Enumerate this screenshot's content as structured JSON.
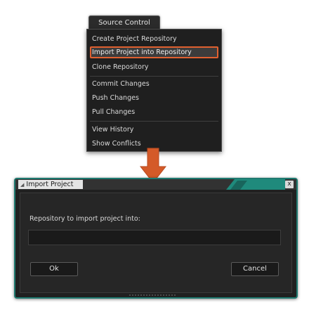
{
  "menu": {
    "title": "Source Control",
    "items": [
      {
        "label": "Create Project Repository"
      },
      {
        "label": "Import Project into Repository"
      },
      {
        "label": "Clone Repository"
      },
      {
        "label": "Commit Changes"
      },
      {
        "label": "Push Changes"
      },
      {
        "label": "Pull Changes"
      },
      {
        "label": "View History"
      },
      {
        "label": "Show Conflicts"
      }
    ],
    "selected_item": "Import Project into Repository"
  },
  "dialog": {
    "title": "Import Project",
    "close_label": "x",
    "prompt": "Repository to import project into:",
    "input_value": "",
    "ok_label": "Ok",
    "cancel_label": "Cancel"
  },
  "colors": {
    "highlight": "#e06030",
    "arrow": "#d45a28",
    "dialog_accent": "#1f8a7c",
    "background": "#202020"
  }
}
